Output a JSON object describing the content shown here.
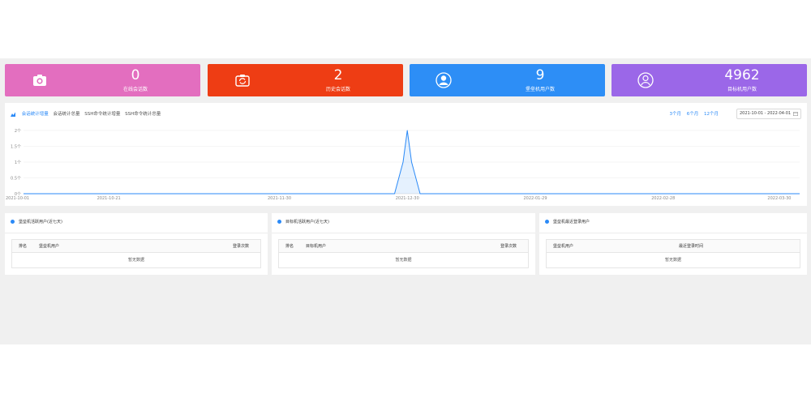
{
  "stats": [
    {
      "value": "0",
      "label": "在线会话数",
      "color": "#e36ebf",
      "icon": "camera-icon"
    },
    {
      "value": "2",
      "label": "历史会话数",
      "color": "#ee3d14",
      "icon": "camera-rotate-icon"
    },
    {
      "value": "9",
      "label": "堡垒机用户数",
      "color": "#2d8ef6",
      "icon": "user-icon"
    },
    {
      "value": "4962",
      "label": "目标机用户数",
      "color": "#9b67e8",
      "icon": "user-outline-icon"
    }
  ],
  "chart_tabs": [
    "会话统计增量",
    "会话统计总量",
    "SSH命令统计增量",
    "SSH命令统计总量"
  ],
  "range_buttons": [
    "3个月",
    "6个月",
    "12个月"
  ],
  "date_range": "2021-10-01 - 2022-04-01",
  "chart_data": {
    "type": "line",
    "x_ticks": [
      "2021-10-01",
      "2021-10-21",
      "2021-11-30",
      "2021-12-30",
      "2022-01-29",
      "2022-02-28",
      "2022-03-30"
    ],
    "y_ticks": [
      "0个",
      "0.5个",
      "1个",
      "1.5个",
      "2个"
    ],
    "ylim": [
      0,
      2
    ],
    "series": [
      {
        "color": "#2b8af7",
        "points": [
          [
            "2021-10-01",
            0
          ],
          [
            "2021-12-27",
            0
          ],
          [
            "2021-12-29",
            1
          ],
          [
            "2021-12-30",
            2
          ],
          [
            "2021-12-31",
            1
          ],
          [
            "2022-01-02",
            0
          ],
          [
            "2022-04-01",
            0
          ]
        ]
      }
    ],
    "grid": true
  },
  "panels": [
    {
      "title": "堡垒机活跃用户(近七天)",
      "columns": [
        "排名",
        "堡垒机用户",
        "登录次数"
      ],
      "empty_text": "暂无数据"
    },
    {
      "title": "目标机活跃用户(近七天)",
      "columns": [
        "排名",
        "目标机用户",
        "登录次数"
      ],
      "empty_text": "暂无数据"
    },
    {
      "title": "堡垒机最近登录用户",
      "columns": [
        "堡垒机用户",
        "最近登录时间"
      ],
      "empty_text": "暂无数据"
    }
  ]
}
